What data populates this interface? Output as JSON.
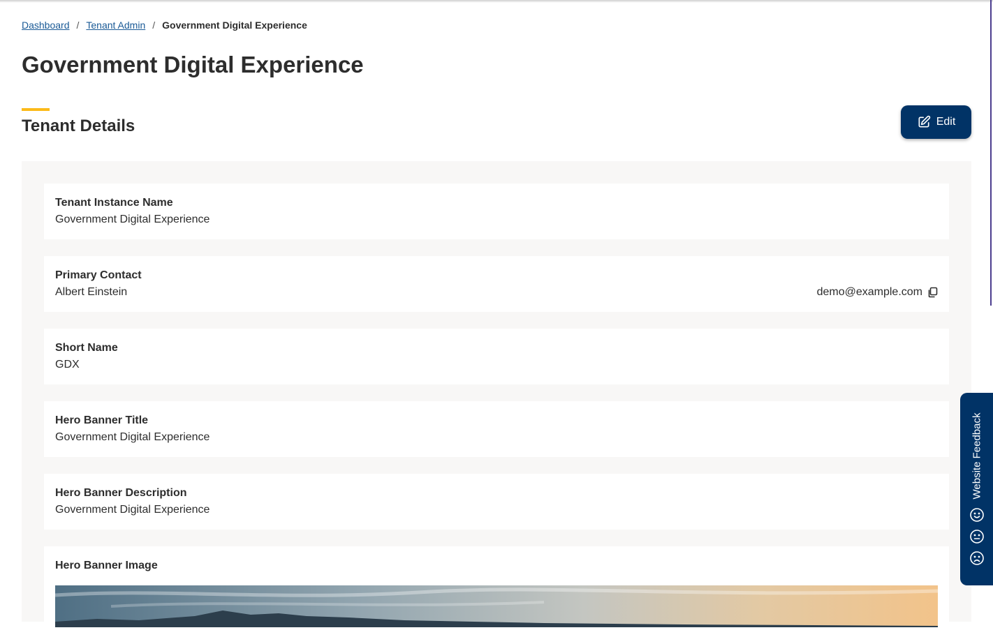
{
  "breadcrumb": {
    "items": [
      "Dashboard",
      "Tenant Admin"
    ],
    "separator": "/",
    "current": "Government Digital Experience"
  },
  "page": {
    "title": "Government Digital Experience",
    "section_title": "Tenant Details",
    "edit_label": "Edit"
  },
  "details": {
    "instance_name": {
      "label": "Tenant Instance Name",
      "value": "Government Digital Experience"
    },
    "primary_contact": {
      "label": "Primary Contact",
      "value": "Albert Einstein",
      "email": "demo@example.com"
    },
    "short_name": {
      "label": "Short Name",
      "value": "GDX"
    },
    "hero_title": {
      "label": "Hero Banner Title",
      "value": "Government Digital Experience"
    },
    "hero_description": {
      "label": "Hero Banner Description",
      "value": "Government Digital Experience"
    },
    "hero_image": {
      "label": "Hero Banner Image"
    }
  },
  "feedback": {
    "label": "Website Feedback",
    "icons": [
      "smile-icon",
      "neutral-face-icon",
      "sad-face-icon"
    ]
  },
  "colors": {
    "primary": "#013366",
    "accent": "#fcba19",
    "link": "#1a5a96",
    "panel_bg": "#f8f7f6"
  }
}
